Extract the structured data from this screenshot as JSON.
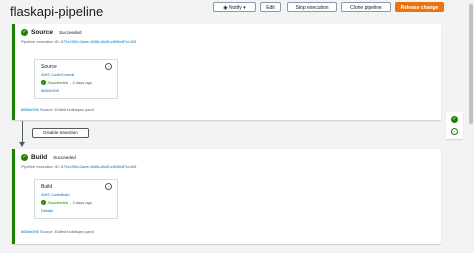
{
  "title": "flaskapi-pipeline",
  "toolbar": {
    "notify": "Notify",
    "edit": "Edit",
    "stop": "Stop execution",
    "clone": "Clone pipeline",
    "release": "Release change"
  },
  "stages": [
    {
      "name": "Source",
      "status": "Succeeded",
      "exec_label": "Pipeline execution ID:",
      "exec_id": "672e105d-2aee-4686-a545-e696e87cc361",
      "action": {
        "name": "Source",
        "provider": "AWS CodeCommit",
        "status": "Succeeded",
        "ago": "- 4 days ago",
        "rev": "8680e396"
      },
      "footer_rev": "8680e396",
      "footer_text": "Source: Edited buildspec.yaml"
    },
    {
      "name": "Build",
      "status": "Succeeded",
      "exec_label": "Pipeline execution ID:",
      "exec_id": "672e105d-2aee-4686-a545-e696e87cc361",
      "action": {
        "name": "Build",
        "provider": "AWS CodeBuild",
        "status": "Succeeded",
        "ago": "- 3 days ago",
        "rev": "Details"
      },
      "footer_rev": "8680e396",
      "footer_text": "Source: Edited buildspec.yaml"
    }
  ],
  "transition": {
    "disable": "Disable transition"
  },
  "icons": {
    "success": "check-circle-icon",
    "info": "info-icon",
    "notify": "chevron-down-icon"
  },
  "colors": {
    "success": "#1d8102",
    "link": "#0073bb",
    "primary": "#ec7211"
  }
}
